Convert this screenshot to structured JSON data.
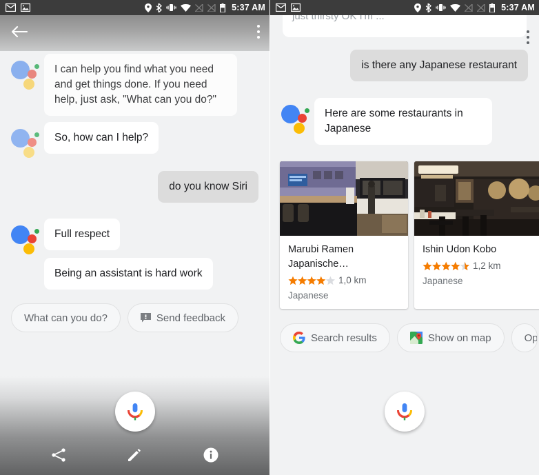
{
  "statusbar": {
    "time": "5:37 AM",
    "icons": [
      "gmail-icon",
      "photos-icon",
      "location-icon",
      "bluetooth-icon",
      "vibrate-icon",
      "wifi-icon",
      "signal-off-icon",
      "signal-off-2-icon",
      "battery-icon"
    ]
  },
  "left": {
    "header": {
      "back_label": "Back",
      "menu_label": "More options"
    },
    "messages": [
      {
        "from": "assistant",
        "avatar": true,
        "faded": true,
        "text": "I can help you find what you need and get things done. If you need help, just ask, \"What can you do?\""
      },
      {
        "from": "assistant",
        "avatar": true,
        "faded": true,
        "text": "So, how can I help?"
      },
      {
        "from": "user",
        "text": "do you know Siri"
      },
      {
        "from": "assistant",
        "avatar": true,
        "text": "Full respect"
      },
      {
        "from": "assistant",
        "avatar": false,
        "text": "Being an assistant is hard work"
      }
    ],
    "chips": [
      {
        "label": "What can you do?",
        "icon": null
      },
      {
        "label": "Send feedback",
        "icon": "feedback-icon"
      }
    ],
    "nav": [
      {
        "name": "share-icon",
        "label": "Share"
      },
      {
        "name": "edit-icon",
        "label": "Edit"
      },
      {
        "name": "info-icon",
        "label": "Info"
      }
    ],
    "mic_label": "Microphone"
  },
  "right": {
    "cut_bubble_text": "just thirsty OK I'm ...",
    "messages": [
      {
        "from": "user",
        "text": "is there any Japanese restaurant"
      },
      {
        "from": "assistant",
        "avatar": true,
        "text": "Here are some restaurants in Japanese"
      }
    ],
    "cards": [
      {
        "title": "Marubi Ramen Japanische…",
        "rating": 4,
        "distance": "1,0 km",
        "category": "Japanese",
        "photo": "restaurant-interior-bar"
      },
      {
        "title": "Ishin Udon Kobo",
        "rating": 4.5,
        "distance": "1,2 km",
        "category": "Japanese",
        "photo": "restaurant-interior-dining"
      }
    ],
    "chips": [
      {
        "label": "Search results",
        "icon": "google-g-icon"
      },
      {
        "label": "Show on map",
        "icon": "google-maps-icon"
      },
      {
        "label": "Op",
        "icon": null
      }
    ],
    "mic_label": "Microphone"
  },
  "colors": {
    "google_blue": "#4285f4",
    "google_red": "#ea4335",
    "google_yellow": "#fbbc05",
    "google_green": "#34a853",
    "star_orange": "#f57c00",
    "star_empty": "#dadce0",
    "bg": "#f1f2f3",
    "user_bubble": "#dcdcdc",
    "statusbar": "#3c3c3c"
  }
}
